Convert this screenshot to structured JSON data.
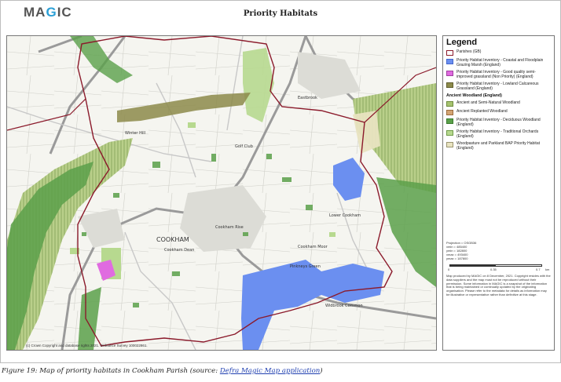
{
  "header": {
    "logo_prefix": "MA",
    "logo_g": "G",
    "logo_suffix": "IC",
    "title": "Priority Habitats"
  },
  "map": {
    "copyright": "(c) Crown Copyright and database rights 2021. Ordnance Survey 100022861.",
    "labels": {
      "cookham": "COOKHAM",
      "cookham_dean": "Cookham Dean",
      "winter_hill": "Winter Hill",
      "cookham_rise": "Cookham Rise",
      "pinkneys_green": "Pinkneys Green",
      "cookham_moor": "Cookham Moor",
      "lower_cookham": "Lower Cookham",
      "golf_club": "Golf Club",
      "widbrook": "Widbrook Common",
      "eastbrook": "Eastbrook"
    }
  },
  "legend": {
    "title": "Legend",
    "items_top": [
      {
        "label": "Parishes (GB)",
        "color": "#ffffff",
        "border": "#8b1a2b"
      },
      {
        "label": "Priority Habitat Inventory - Coastal and Floodplain Grazing Marsh (England)",
        "color": "#6b8ff0",
        "border": "#4466cc"
      },
      {
        "label": "Priority Habitat Inventory - Good quality semi-improved grassland (Non Priority) (England)",
        "color": "#e06be0",
        "border": "#a040a0"
      },
      {
        "label": "Priority Habitat Inventory - Lowland Calcareous Grassland (England)",
        "color": "#8c8a4a",
        "border": "#5f5d2e"
      }
    ],
    "woodland_heading": "Ancient Woodland (England)",
    "items_bottom": [
      {
        "label": "Ancient and Semi-Natural Woodland",
        "color": "#a6c36f",
        "border": "#6e8b3d"
      },
      {
        "label": "Ancient Replanted Woodland",
        "color": "#d4a574",
        "border": "#9c6b3c"
      },
      {
        "label": "Priority Habitat Inventory - Deciduous Woodland (England)",
        "color": "#5aa04a",
        "border": "#3a7a2e"
      },
      {
        "label": "Priority Habitat Inventory - Traditional Orchards (England)",
        "color": "#b7d98f",
        "border": "#6f9a48"
      },
      {
        "label": "Woodpasture and Parkland BAP Priority Habitat (England)",
        "color": "#e8e3c0",
        "border": "#9a9470"
      }
    ],
    "projection": [
      "Projection = OSGB36",
      "xmin = 485400",
      "ymin = 182800",
      "xmax = 493400",
      "ymax = 187800"
    ],
    "scale_labels": [
      "0",
      "0.35",
      "0.7"
    ],
    "scale_unit": "km",
    "notes": "Map produced by MAGIC on 8 December, 2021. Copyright resides with the data suppliers and the map must not be reproduced without their permission. Some information in MAGIC is a snapshot of the information that is being maintained or continually updated by the originating organisation. Please refer to the metadata for details as information may be illustrative or representative rather than definitive at this stage."
  },
  "caption": {
    "text": "Figure 19: Map of priority habitats in Cookham Parish (source: ",
    "link": "Defra Magic Map application",
    "end": ")"
  }
}
